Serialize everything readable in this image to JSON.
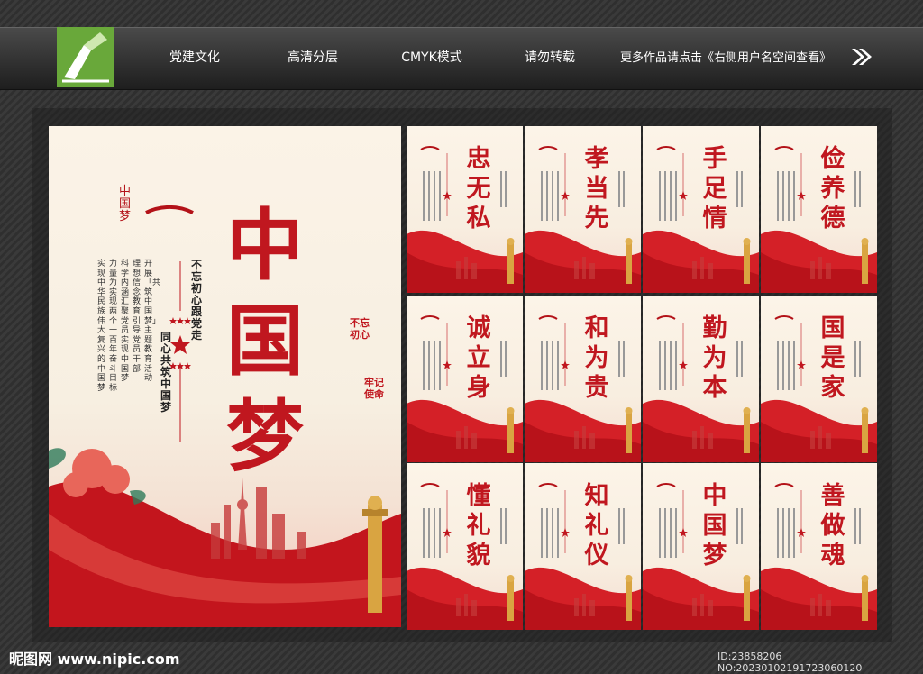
{
  "header": {
    "tags": [
      {
        "label": "党建文化",
        "color": "#c41f2b"
      },
      {
        "label": "高清分层",
        "color": "#3b5a86"
      },
      {
        "label": "CMYK模式",
        "color": "#1d7a74"
      },
      {
        "label": "请勿转载",
        "color": "#7b2b93"
      }
    ],
    "more_text": "更多作品请点击《右侧用户名空间查看》"
  },
  "main_poster": {
    "title": "中国梦",
    "brush_text": "中国梦",
    "slogan_a": "不忘初心跟党走",
    "slogan_b": "同心共筑中国梦",
    "stamp_a": "不忘初心",
    "stamp_b": "牢记使命",
    "body_columns": [
      "开展「共筑中国梦」主题教育活动",
      "理想信念教育引导党员干部",
      "科学内涵汇聚党员实现中国梦",
      "力量为实现两个一百年奋斗目标",
      "实现中华民族伟大复兴的中国梦"
    ]
  },
  "small_posters": [
    {
      "title": "忠无私"
    },
    {
      "title": "孝当先"
    },
    {
      "title": "手足情"
    },
    {
      "title": "俭养德"
    },
    {
      "title": "诚立身"
    },
    {
      "title": "和为贵"
    },
    {
      "title": "勤为本"
    },
    {
      "title": "国是家"
    },
    {
      "title": "懂礼貌"
    },
    {
      "title": "知礼仪"
    },
    {
      "title": "中国梦"
    },
    {
      "title": "善做魂"
    }
  ],
  "footer": {
    "site": "昵图网 www.nipic.com",
    "id_text": "ID:23858206 NO:20230102191723060120"
  },
  "colors": {
    "party_red": "#c0171f",
    "gold": "#d9a441"
  }
}
